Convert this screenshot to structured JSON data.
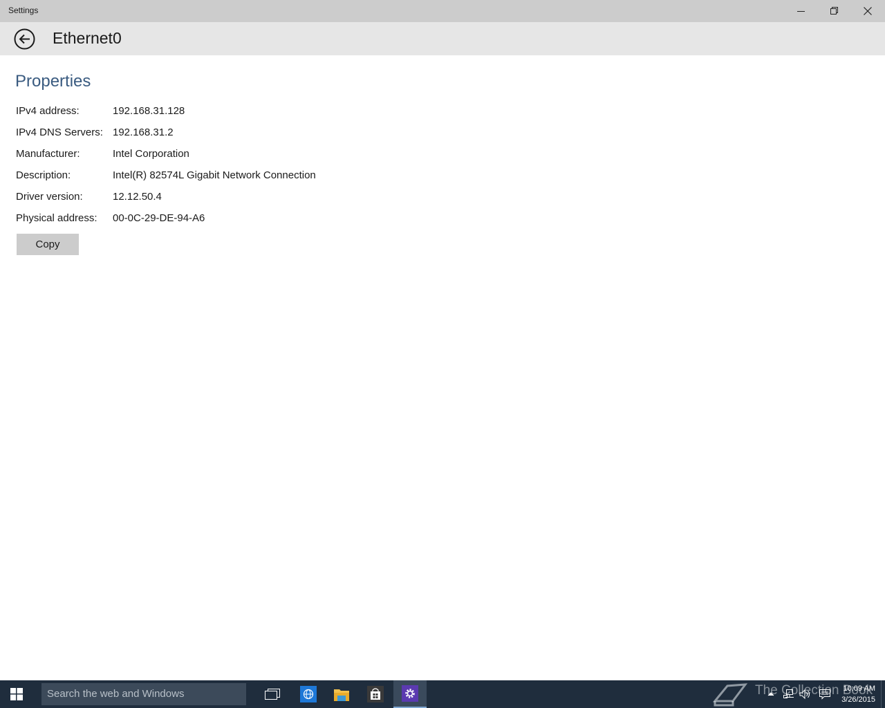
{
  "window": {
    "title": "Settings"
  },
  "header": {
    "title": "Ethernet0"
  },
  "properties": {
    "heading": "Properties",
    "rows": [
      {
        "label": "IPv4 address:",
        "value": "192.168.31.128"
      },
      {
        "label": "IPv4 DNS Servers:",
        "value": "192.168.31.2"
      },
      {
        "label": "Manufacturer:",
        "value": "Intel Corporation"
      },
      {
        "label": "Description:",
        "value": "Intel(R) 82574L Gigabit Network Connection"
      },
      {
        "label": "Driver version:",
        "value": "12.12.50.4"
      },
      {
        "label": "Physical address:",
        "value": "00-0C-29-DE-94-A6"
      }
    ],
    "copy_label": "Copy"
  },
  "taskbar": {
    "search_placeholder": "Search the web and Windows",
    "apps": [
      "task-view",
      "internet-explorer",
      "file-explorer",
      "store",
      "settings"
    ],
    "active_app": "settings",
    "watermark": "The Collection Book",
    "clock": {
      "time": "10:09 AM",
      "date": "3/26/2015"
    }
  },
  "colors": {
    "titlebar": "#cccccc",
    "header": "#e6e6e6",
    "section_heading": "#3a5b80",
    "taskbar": "#1f2d3d",
    "settings_accent": "#5b3ab0"
  }
}
